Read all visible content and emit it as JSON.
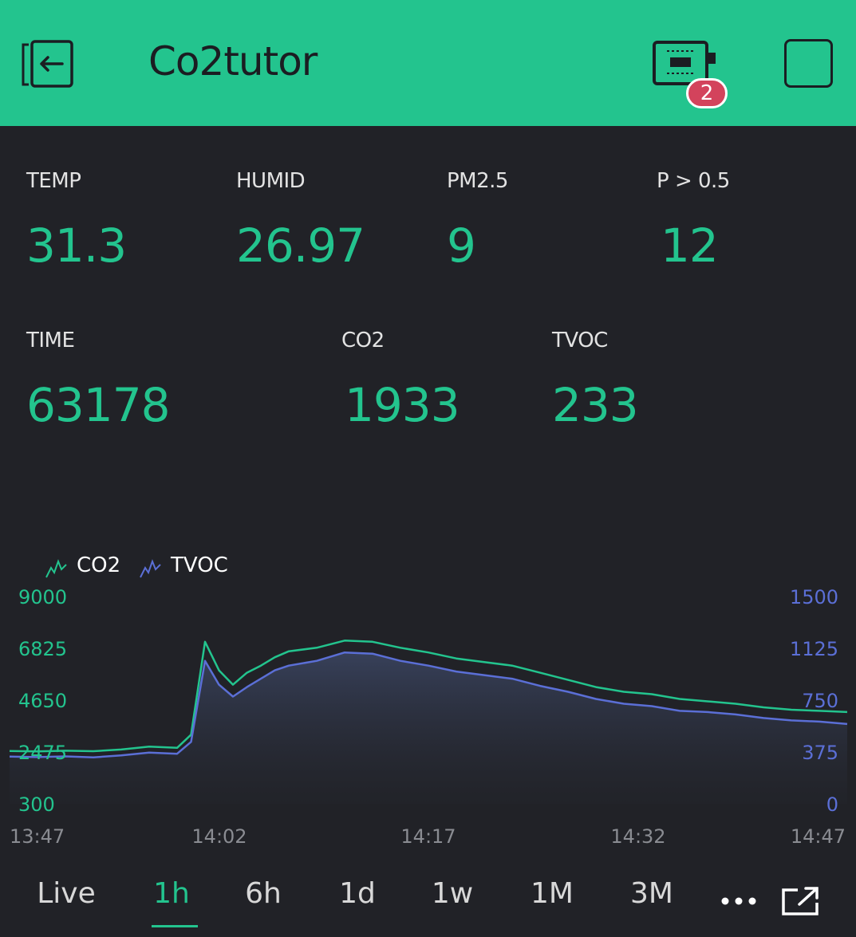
{
  "header": {
    "title": "Co2tutor",
    "badge_count": "2",
    "icons": [
      "exit-icon",
      "device-icon",
      "square-icon"
    ],
    "bg_color": "#23c48e"
  },
  "widgets": [
    {
      "label": "TEMP",
      "value": "31.3"
    },
    {
      "label": "HUMID",
      "value": "26.97"
    },
    {
      "label": "PM2.5",
      "value": "9"
    },
    {
      "label": "P > 0.5",
      "value": "12"
    },
    {
      "label": "TIME",
      "value": "63178"
    },
    {
      "label": "CO2",
      "value": "1933"
    },
    {
      "label": "TVOC",
      "value": "233"
    }
  ],
  "legend": [
    {
      "name": "CO2",
      "color": "#23c48e"
    },
    {
      "name": "TVOC",
      "color": "#5b6fd6"
    }
  ],
  "tabs": [
    "Live",
    "1h",
    "6h",
    "1d",
    "1w",
    "1M",
    "3M"
  ],
  "active_tab": "1h",
  "more_label": "•••",
  "chart_data": {
    "type": "line",
    "left_axis": {
      "ticks": [
        "9000",
        "6825",
        "4650",
        "2475",
        "300"
      ],
      "range": [
        300,
        9000
      ],
      "color": "#23c48e"
    },
    "right_axis": {
      "ticks": [
        "1500",
        "1125",
        "750",
        "375",
        "0"
      ],
      "range": [
        0,
        1500
      ],
      "color": "#5b6fd6"
    },
    "x_ticks": [
      "13:47",
      "14:02",
      "14:17",
      "14:32",
      "14:47"
    ],
    "x_minutes": [
      0,
      2,
      4,
      6,
      8,
      10,
      12,
      13,
      14,
      15,
      16,
      17,
      18,
      19,
      20,
      22,
      24,
      26,
      28,
      30,
      32,
      34,
      36,
      38,
      40,
      42,
      44,
      46,
      48,
      50,
      52,
      54,
      56,
      58,
      60
    ],
    "series": [
      {
        "name": "CO2",
        "axis": "left",
        "color": "#23c48e",
        "values": [
          2520,
          2500,
          2530,
          2510,
          2580,
          2700,
          2650,
          3200,
          7100,
          5900,
          5300,
          5800,
          6100,
          6450,
          6700,
          6850,
          7150,
          7100,
          6850,
          6650,
          6400,
          6250,
          6100,
          5800,
          5500,
          5200,
          5000,
          4900,
          4700,
          4600,
          4500,
          4350,
          4250,
          4200,
          4150
        ]
      },
      {
        "name": "TVOC",
        "axis": "left",
        "color": "#5b6fd6",
        "values": [
          2280,
          2260,
          2290,
          2250,
          2330,
          2450,
          2400,
          2900,
          6300,
          5300,
          4800,
          5200,
          5550,
          5900,
          6100,
          6300,
          6650,
          6600,
          6300,
          6100,
          5850,
          5700,
          5550,
          5250,
          5000,
          4700,
          4500,
          4400,
          4200,
          4150,
          4050,
          3900,
          3800,
          3750,
          3650
        ]
      }
    ]
  }
}
